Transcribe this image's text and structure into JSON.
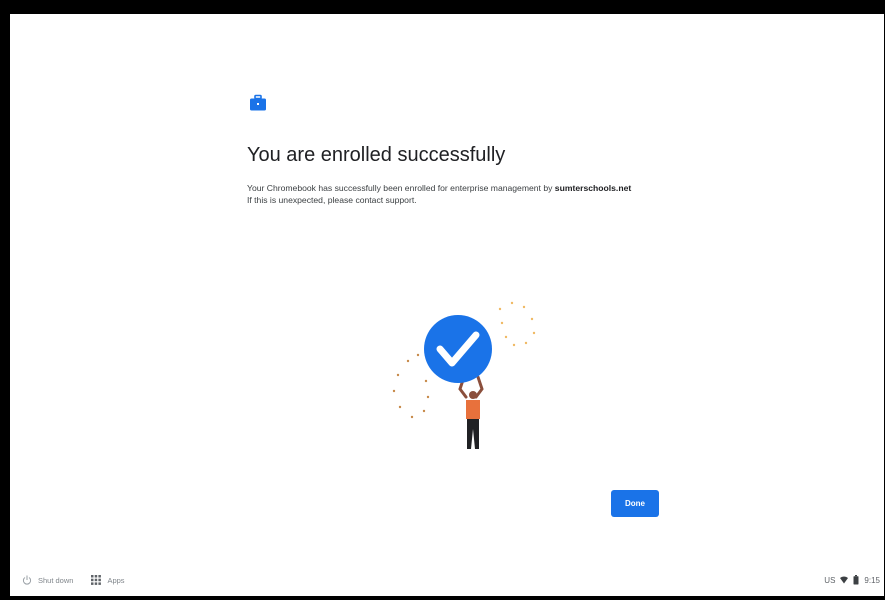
{
  "enrollment": {
    "title": "You are enrolled successfully",
    "desc_prefix": "Your Chromebook has successfully been enrolled for enterprise management by ",
    "domain": "sumterschools.net",
    "desc_line2": "If this is unexpected, please contact support."
  },
  "actions": {
    "done_label": "Done"
  },
  "shelf": {
    "shutdown_label": "Shut down",
    "apps_label": "Apps"
  },
  "status": {
    "input_method": "US",
    "time": "9:15"
  },
  "icons": {
    "enterprise": "briefcase-icon",
    "shutdown": "power-icon",
    "apps": "grid-icon",
    "wifi": "wifi-icon",
    "battery": "battery-icon"
  },
  "colors": {
    "accent": "#1a73e8",
    "checkmark_circle": "#1a73e8",
    "person_shirt": "#e8713c"
  }
}
